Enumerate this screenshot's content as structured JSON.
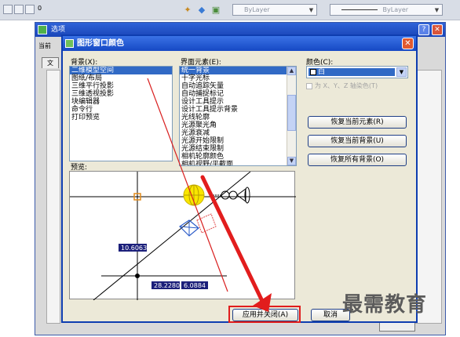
{
  "toolbar": {
    "layer_field": "0",
    "linetype_value": "ByLayer",
    "lineweight_value": "ByLayer"
  },
  "back_window": {
    "title": "选项",
    "current_label": "当前",
    "tab_label": "文"
  },
  "dialog": {
    "title": "图形窗口颜色",
    "context_label": "背景(X):",
    "context_items": [
      "二维模型空间",
      "图纸/布局",
      "三维平行投影",
      "三维透视投影",
      "块编辑器",
      "命令行",
      "打印预览"
    ],
    "context_selected_index": 0,
    "element_label": "界面元素(E):",
    "element_items": [
      "统一背景",
      "十字光标",
      "自动追踪矢量",
      "自动捕捉标记",
      "设计工具提示",
      "设计工具提示背景",
      "光线轮廓",
      "光源聚光角",
      "光源衰减",
      "光源开始限制",
      "光源结束限制",
      "相机轮廓颜色",
      "相机视野/平截面"
    ],
    "element_selected_index": 0,
    "color_label": "颜色(C):",
    "color_value": "白",
    "tint_label": "为 X、Y、Z 轴染色(T)",
    "restore_current_element": "恢复当前元素(R)",
    "restore_current_context": "恢复当前背景(U)",
    "restore_all_contexts": "恢复所有背景(O)",
    "preview_label": "预览:",
    "preview_dim1": "10.6063",
    "preview_dim2": "28.2280",
    "preview_dim3": "6.0884",
    "apply_close": "应用并关闭(A)",
    "cancel": "取消"
  },
  "watermark": "最需教育",
  "colors": {
    "selection": "#316ac5",
    "title_bar": "#1649c4",
    "highlight": "#e01c1c",
    "preview_bg": "#ffffff"
  }
}
